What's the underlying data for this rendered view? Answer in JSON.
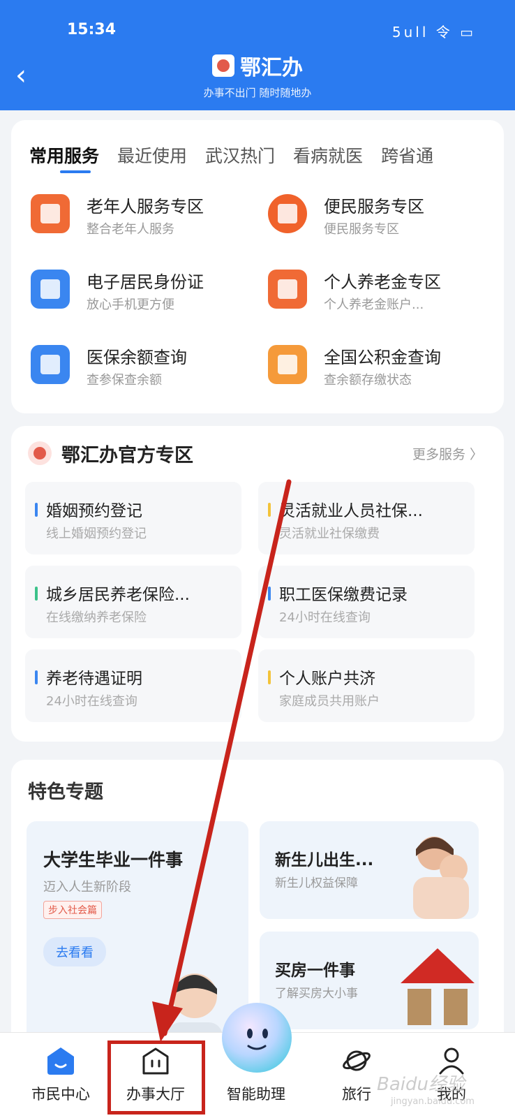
{
  "status_bar": {
    "time": "15:34",
    "icons": "5ull 令 ▭"
  },
  "header": {
    "title": "鄂汇办",
    "subtitle": "办事不出门 随时随地办"
  },
  "common_services": {
    "tabs": [
      "常用服务",
      "最近使用",
      "武汉热门",
      "看病就医",
      "跨省通"
    ],
    "items": [
      {
        "title": "老年人服务专区",
        "subtitle": "整合老年人服务",
        "color": "#f06a35",
        "icon": "elderly-icon"
      },
      {
        "title": "便民服务专区",
        "subtitle": "便民服务专区",
        "color": "#f0622b",
        "icon": "hands-icon"
      },
      {
        "title": "电子居民身份证",
        "subtitle": "放心手机更方便",
        "color": "#3a86f0",
        "icon": "id-card-icon"
      },
      {
        "title": "个人养老金专区",
        "subtitle": "个人养老金账户...",
        "color": "#f06a35",
        "icon": "pension-icon"
      },
      {
        "title": "医保余额查询",
        "subtitle": "查参保查余额",
        "color": "#3a86f0",
        "icon": "medical-card-icon"
      },
      {
        "title": "全国公积金查询",
        "subtitle": "查余额存缴状态",
        "color": "#f59a3a",
        "icon": "house-fund-icon"
      }
    ]
  },
  "official_zone": {
    "title": "鄂汇办官方专区",
    "more": "更多服务 〉",
    "items": [
      {
        "title": "婚姻预约登记",
        "subtitle": "线上婚姻预约登记",
        "color": "#3a86f0"
      },
      {
        "title": "灵活就业人员社保...",
        "subtitle": "灵活就业社保缴费",
        "color": "#f3c33a"
      },
      {
        "title": "城乡居民养老保险...",
        "subtitle": "在线缴纳养老保险",
        "color": "#3cc28a"
      },
      {
        "title": "职工医保缴费记录",
        "subtitle": "24小时在线查询",
        "color": "#3a86f0"
      },
      {
        "title": "养老待遇证明",
        "subtitle": "24小时在线查询",
        "color": "#3a86f0"
      },
      {
        "title": "个人账户共济",
        "subtitle": "家庭成员共用账户",
        "color": "#f3c33a"
      }
    ]
  },
  "featured": {
    "title": "特色专题",
    "big": {
      "title": "大学生毕业一件事",
      "subtitle": "迈入人生新阶段",
      "badge": "步入社会篇",
      "button": "去看看"
    },
    "small": [
      {
        "title": "新生儿出生...",
        "subtitle": "新生儿权益保障"
      },
      {
        "title": "买房一件事",
        "subtitle": "了解买房大小事"
      }
    ]
  },
  "tabbar": {
    "items": [
      {
        "label": "市民中心",
        "icon": "citizen-center-icon"
      },
      {
        "label": "办事大厅",
        "icon": "service-hall-icon"
      },
      {
        "label": "智能助理",
        "icon": "smart-assistant-icon"
      },
      {
        "label": "旅行",
        "icon": "travel-icon"
      },
      {
        "label": "我的",
        "icon": "profile-icon"
      }
    ]
  },
  "watermark": {
    "text": "Baidu经验",
    "sub": "jingyan.baidu.com"
  },
  "colors": {
    "primary": "#2b7bf0",
    "annotation": "#c8241c"
  }
}
